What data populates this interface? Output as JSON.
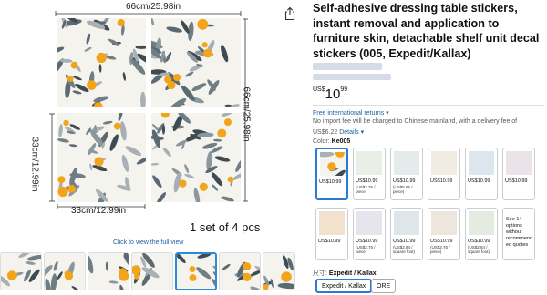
{
  "gallery": {
    "top_dimension": "66cm/25.98in",
    "right_dimension": "66cm/25.98in",
    "left_dimension": "33cm/12.99in",
    "bottom_dimension": "33cm/12.99in",
    "set_label": "1 set of 4 pcs",
    "view_full_label": "Click to view the full view",
    "thumbnail_count": 7,
    "selected_thumbnail_index": 4
  },
  "product": {
    "title": "Self-adhesive dressing table stickers, instant removal and application to furniture skin, detachable shelf unit decal stickers (005, Expedit/Kallax)",
    "price": {
      "currency": "US$",
      "whole": "10",
      "fraction": "99"
    },
    "returns_label": "Free international returns",
    "returns_chevron": "▾",
    "import_note": "No import fee will be charged to Chinese mainland, with a delivery fee of",
    "delivery_fee": "US$6.22",
    "details_label": "Details",
    "details_chevron": "▾",
    "color_label": "Color:",
    "color_value": "Ke005",
    "size_label": "尺寸:",
    "size_value": "Expedit / Kallax"
  },
  "color_options_row1": [
    {
      "price": "US$10.99",
      "sub": ""
    },
    {
      "price": "US$10.99",
      "sub": "(US$2.75 / piece)"
    },
    {
      "price": "US$10.99",
      "sub": "(US$5.66 / piece)"
    },
    {
      "price": "US$10.99",
      "sub": ""
    },
    {
      "price": "US$10.99",
      "sub": ""
    },
    {
      "price": "US$10.99",
      "sub": ""
    }
  ],
  "color_options_row2": [
    {
      "price": "US$10.99",
      "sub": ""
    },
    {
      "price": "US$10.99",
      "sub": "(US$2.75 / piece)"
    },
    {
      "price": "US$10.99",
      "sub": "(US$2.84 / square foot)"
    },
    {
      "price": "US$10.99",
      "sub": "(US$2.75 / piece)"
    },
    {
      "price": "US$10.99",
      "sub": "(US$2.84 / square foot)"
    }
  ],
  "more_options_label": "See 14 options without recommend ed quotes",
  "size_options": [
    "Expedit / Kallax",
    "ORE"
  ],
  "share_icon": "share-icon",
  "colors": {
    "accent": "#2162a1",
    "selected_border": "#2a7ad8",
    "leaf": "#5b6a72",
    "fruit": "#f2a41b"
  }
}
